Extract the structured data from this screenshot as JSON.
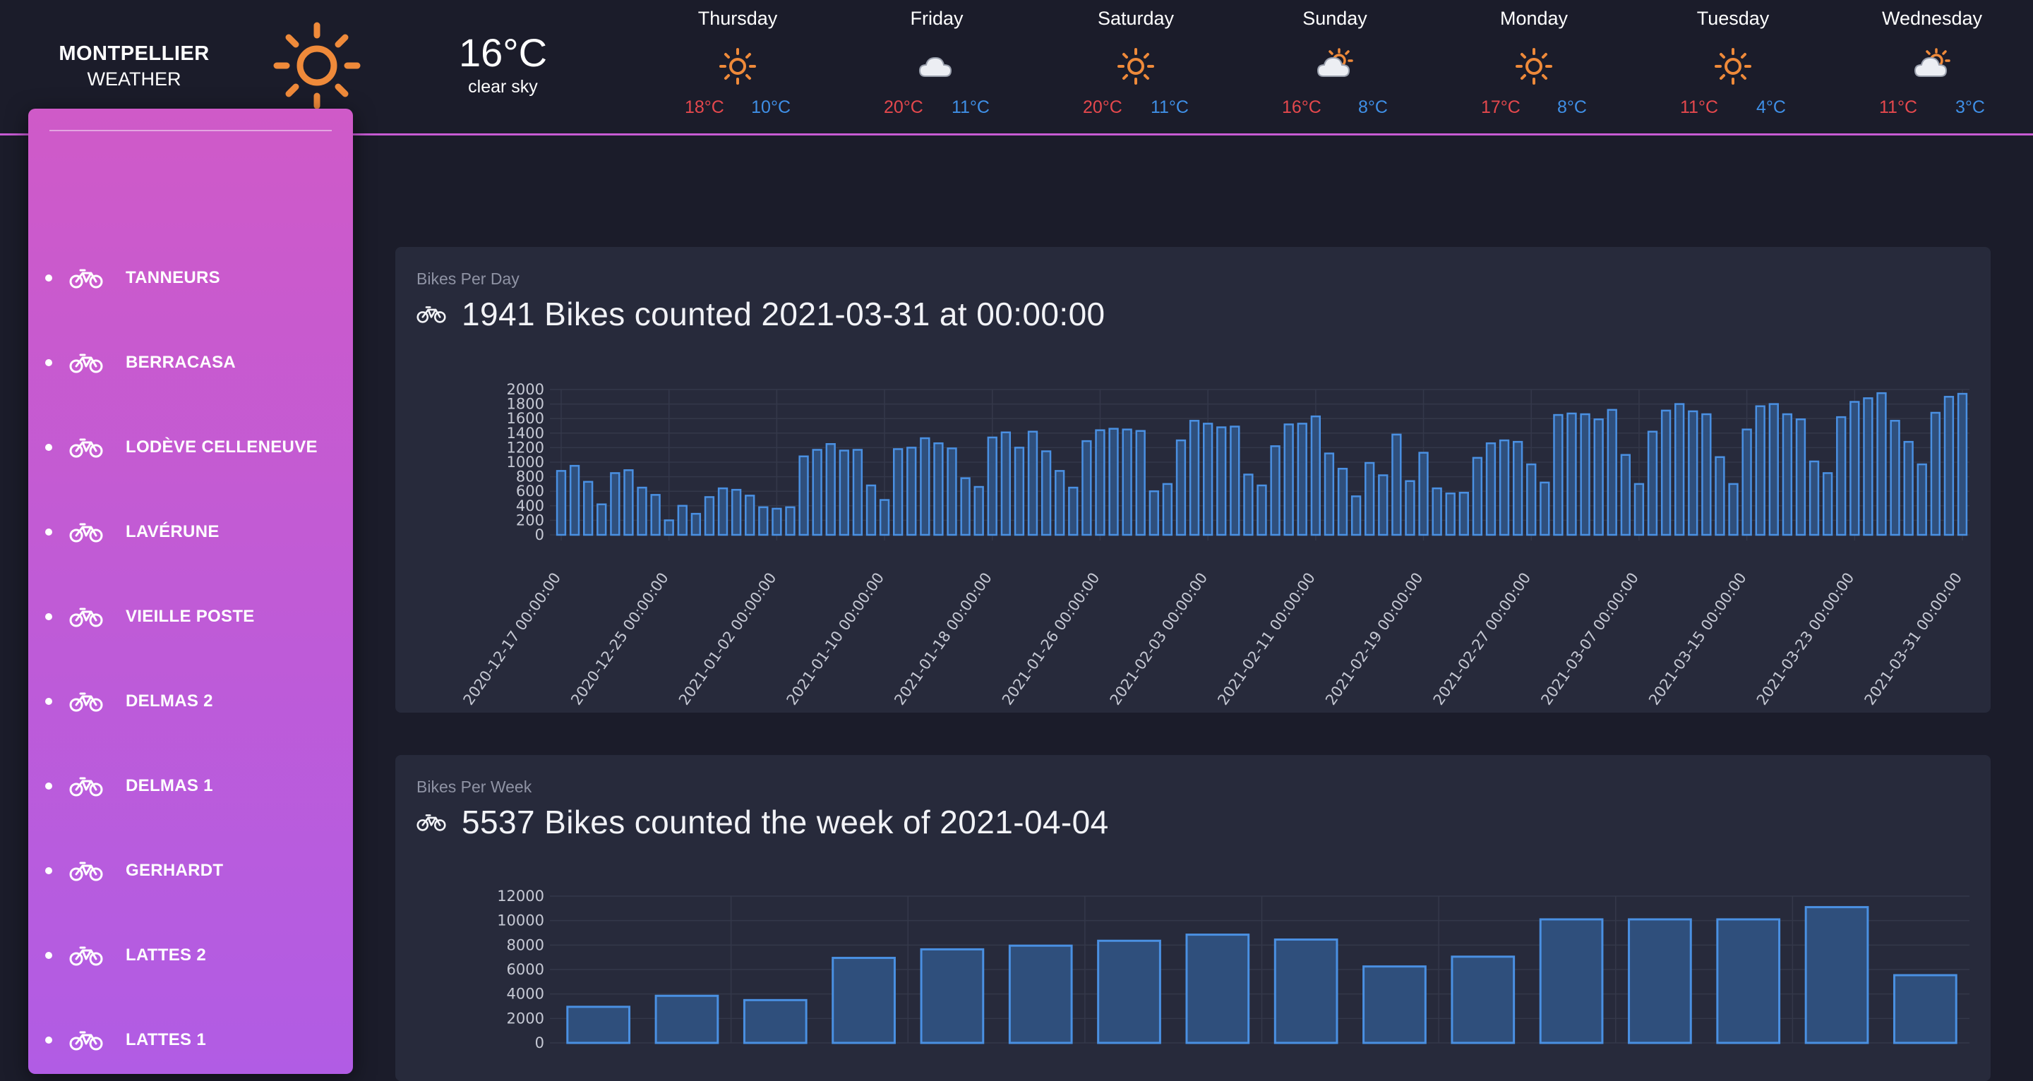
{
  "header": {
    "city": "MONTPELLIER",
    "subtitle": "WEATHER",
    "current": {
      "temp": "16°C",
      "desc": "clear sky",
      "icon": "sun-icon"
    },
    "forecast": [
      {
        "day": "Thursday",
        "icon": "sun-icon",
        "max": "18°C",
        "min": "10°C"
      },
      {
        "day": "Friday",
        "icon": "cloud-icon",
        "max": "20°C",
        "min": "11°C"
      },
      {
        "day": "Saturday",
        "icon": "sun-icon",
        "max": "20°C",
        "min": "11°C"
      },
      {
        "day": "Sunday",
        "icon": "sun-cloud-icon",
        "max": "16°C",
        "min": "8°C"
      },
      {
        "day": "Monday",
        "icon": "sun-icon",
        "max": "17°C",
        "min": "8°C"
      },
      {
        "day": "Tuesday",
        "icon": "sun-icon",
        "max": "11°C",
        "min": "4°C"
      },
      {
        "day": "Wednesday",
        "icon": "sun-cloud-icon",
        "max": "11°C",
        "min": "3°C"
      }
    ]
  },
  "sidebar": {
    "items": [
      {
        "label": "TANNEURS"
      },
      {
        "label": "BERRACASA"
      },
      {
        "label": "LODÈVE CELLENEUVE"
      },
      {
        "label": "LAVÉRUNE"
      },
      {
        "label": "VIEILLE POSTE"
      },
      {
        "label": "DELMAS 2"
      },
      {
        "label": "DELMAS 1"
      },
      {
        "label": "GERHARDT"
      },
      {
        "label": "LATTES 2"
      },
      {
        "label": "LATTES 1"
      }
    ]
  },
  "daily": {
    "title": "Bikes Per Day",
    "headline": "1941 Bikes counted 2021-03-31 at 00:00:00"
  },
  "weekly": {
    "title": "Bikes Per Week",
    "headline": "5537 Bikes counted the week of 2021-04-04"
  },
  "colors": {
    "accent": "#c75bd4",
    "bar_stroke": "#4a90e2",
    "bar_fill": "#2f4f7c",
    "max_temp": "#e5484d",
    "min_temp": "#3f8fe6"
  },
  "chart_data": [
    {
      "type": "bar",
      "title": "Bikes Per Day",
      "ylim": [
        0,
        2000
      ],
      "yticks": [
        0,
        200,
        400,
        600,
        800,
        1000,
        1200,
        1400,
        1600,
        1800,
        2000
      ],
      "xtick_labels": [
        "2020-12-17 00:00:00",
        "2020-12-25 00:00:00",
        "2021-01-02 00:00:00",
        "2021-01-10 00:00:00",
        "2021-01-18 00:00:00",
        "2021-01-26 00:00:00",
        "2021-02-03 00:00:00",
        "2021-02-11 00:00:00",
        "2021-02-19 00:00:00",
        "2021-02-27 00:00:00",
        "2021-03-07 00:00:00",
        "2021-03-15 00:00:00",
        "2021-03-23 00:00:00",
        "2021-03-31 00:00:00"
      ],
      "x_start": "2020-12-17",
      "values": [
        880,
        950,
        730,
        420,
        850,
        890,
        650,
        550,
        200,
        400,
        290,
        520,
        640,
        620,
        540,
        380,
        360,
        380,
        1080,
        1170,
        1250,
        1160,
        1170,
        680,
        480,
        1180,
        1200,
        1330,
        1260,
        1190,
        780,
        660,
        1340,
        1410,
        1200,
        1420,
        1150,
        880,
        650,
        1290,
        1440,
        1460,
        1450,
        1430,
        600,
        700,
        1300,
        1570,
        1530,
        1480,
        1490,
        830,
        680,
        1220,
        1520,
        1530,
        1630,
        1120,
        910,
        530,
        990,
        820,
        1380,
        740,
        1130,
        640,
        570,
        580,
        1060,
        1260,
        1300,
        1280,
        970,
        720,
        1650,
        1670,
        1660,
        1590,
        1720,
        1100,
        700,
        1420,
        1710,
        1800,
        1700,
        1660,
        1070,
        700,
        1450,
        1770,
        1800,
        1660,
        1590,
        1010,
        850,
        1620,
        1830,
        1880,
        1950,
        1570,
        1280,
        970,
        1680,
        1900,
        1941
      ]
    },
    {
      "type": "bar",
      "title": "Bikes Per Week",
      "ylim": [
        0,
        12000
      ],
      "yticks": [
        0,
        2000,
        4000,
        6000,
        8000,
        10000,
        12000
      ],
      "values": [
        2950,
        3850,
        3500,
        6950,
        7650,
        7950,
        8350,
        8850,
        8450,
        6250,
        7050,
        10100,
        10100,
        10100,
        11100,
        5537
      ]
    }
  ]
}
